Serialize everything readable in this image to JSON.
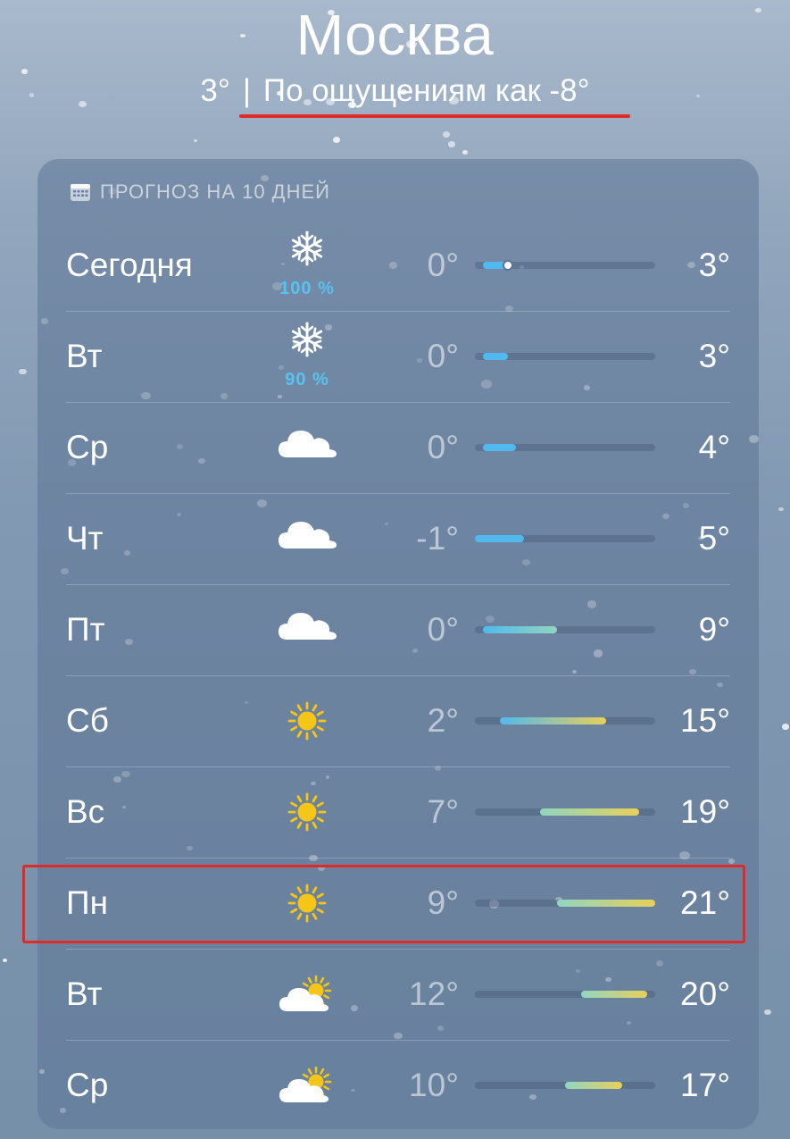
{
  "location": {
    "city": "Москва",
    "current_temp": "3°",
    "separator": "|",
    "feels_like": "По ощущениям как -8°"
  },
  "forecast": {
    "title": "ПРОГНОЗ НА 10 ДНЕЙ",
    "icon": "calendar-icon",
    "scale_min": -1,
    "scale_max": 21,
    "days": [
      {
        "day": "Сегодня",
        "icon": "snow",
        "precip": "100 %",
        "low": "0°",
        "high": "3°",
        "low_val": 0,
        "high_val": 3,
        "current": 3
      },
      {
        "day": "Вт",
        "icon": "snow",
        "precip": "90 %",
        "low": "0°",
        "high": "3°",
        "low_val": 0,
        "high_val": 3
      },
      {
        "day": "Ср",
        "icon": "cloud",
        "precip": "",
        "low": "0°",
        "high": "4°",
        "low_val": 0,
        "high_val": 4
      },
      {
        "day": "Чт",
        "icon": "cloud",
        "precip": "",
        "low": "-1°",
        "high": "5°",
        "low_val": -1,
        "high_val": 5
      },
      {
        "day": "Пт",
        "icon": "cloud",
        "precip": "",
        "low": "0°",
        "high": "9°",
        "low_val": 0,
        "high_val": 9
      },
      {
        "day": "Сб",
        "icon": "sun",
        "precip": "",
        "low": "2°",
        "high": "15°",
        "low_val": 2,
        "high_val": 15
      },
      {
        "day": "Вс",
        "icon": "sun",
        "precip": "",
        "low": "7°",
        "high": "19°",
        "low_val": 7,
        "high_val": 19
      },
      {
        "day": "Пн",
        "icon": "sun",
        "precip": "",
        "low": "9°",
        "high": "21°",
        "low_val": 9,
        "high_val": 21
      },
      {
        "day": "Вт",
        "icon": "partly-cloudy",
        "precip": "",
        "low": "12°",
        "high": "20°",
        "low_val": 12,
        "high_val": 20
      },
      {
        "day": "Ср",
        "icon": "partly-cloudy",
        "precip": "",
        "low": "10°",
        "high": "17°",
        "low_val": 10,
        "high_val": 17
      }
    ]
  },
  "colors": {
    "highlight": "#e02a25",
    "precip": "#58c3f0",
    "cold": "#52b9ee",
    "mild": "#8fd6c0",
    "warm": "#e8d05a"
  }
}
